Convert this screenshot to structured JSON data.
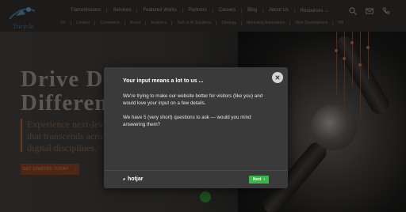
{
  "nav": {
    "items": [
      "Transmissions",
      "Services",
      "Featured Works",
      "Partners",
      "Careers",
      "Blog",
      "About Us",
      "Resources"
    ],
    "subitems": [
      "UX",
      "Content",
      "Commerce",
      "Brand",
      "Analytics",
      "Tech & AI Solutions",
      "Strategy",
      "Marketing Automation",
      "Web Development",
      "PR"
    ]
  },
  "logo": {
    "text": "Tricycle"
  },
  "hero": {
    "title_line1": "Drive Dig",
    "title_line2": "Differen",
    "para_line1": "Experience next-lev",
    "para_line2": "that transcends acro",
    "para_line3": "digital disciplines.",
    "cta_label": "GET STARTED TODAY",
    "cta_arrow": "→"
  },
  "survey": {
    "title": "Your input means a lot to us ...",
    "body1": "We're trying to make our website better for visitors (like you) and would love your input on a few details.",
    "body2": "We have 5 (very short) questions to ask — would you mind answering them?",
    "brand": "hotjar",
    "next_label": "Next",
    "next_arrow": "›"
  },
  "colors": {
    "accent_orange": "#9c5a2e",
    "next_green": "#3cb54a",
    "modal_bg": "#3a3a3a"
  },
  "icons": [
    "search-icon",
    "mail-icon",
    "phone-icon",
    "close-icon",
    "hotjar-flame-icon",
    "chevron-right-icon",
    "chevron-down-icon"
  ]
}
